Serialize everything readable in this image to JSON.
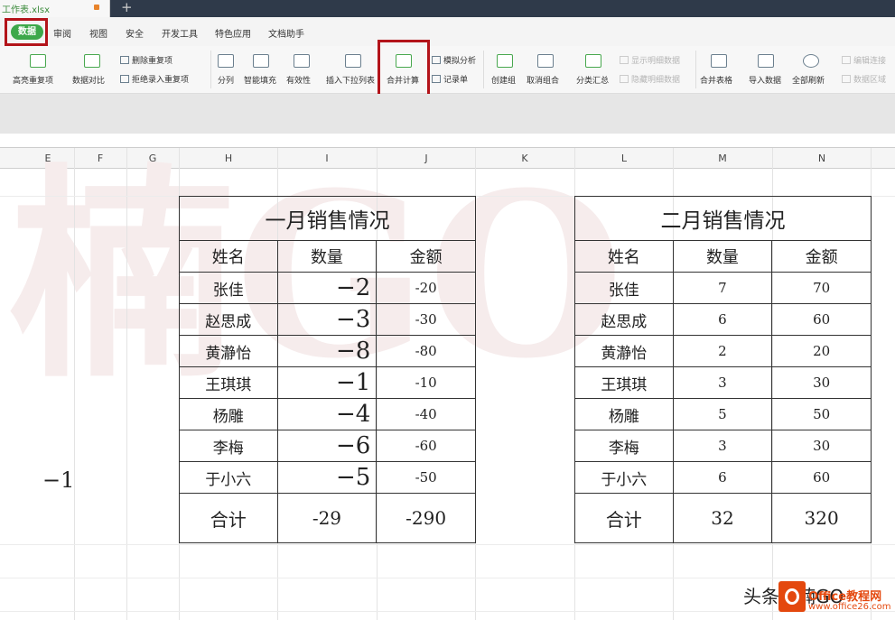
{
  "window": {
    "file_tab": "工作表.xlsx",
    "new_tab_icon": "plus-icon"
  },
  "menu": {
    "items": [
      "数据",
      "审阅",
      "视图",
      "安全",
      "开发工具",
      "特色应用",
      "文档助手"
    ]
  },
  "ribbon": {
    "highlight_dup": "高亮重复项",
    "data_compare": "数据对比",
    "delete_dup": "删除重复项",
    "reject_dup": "拒绝录入重复项",
    "split": "分列",
    "smart_fill": "智能填充",
    "validity": "有效性",
    "insert_dropdown": "插入下拉列表",
    "merge_calc": "合并计算",
    "simulate": "模拟分析",
    "record": "记录单",
    "create_group": "创建组",
    "ungroup": "取消组合",
    "subtotal": "分类汇总",
    "show_detail": "显示明细数据",
    "hide_detail": "隐藏明细数据",
    "merge_tables": "合并表格",
    "import_data": "导入数据",
    "refresh_all": "全部刷新",
    "edit_links": "编辑连接",
    "data_region": "数据区域"
  },
  "columns": [
    "E",
    "F",
    "G",
    "H",
    "I",
    "J",
    "K",
    "L",
    "M",
    "N"
  ],
  "lone_value": "−1",
  "watermark": "楠GO",
  "headers": {
    "name": "姓名",
    "qty": "数量",
    "amount": "金额"
  },
  "january": {
    "title": "一月销售情况",
    "rows": [
      {
        "name": "张佳",
        "qty": "−2",
        "amount": "-20"
      },
      {
        "name": "赵思成",
        "qty": "−3",
        "amount": "-30"
      },
      {
        "name": "黄瀞怡",
        "qty": "−8",
        "amount": "-80"
      },
      {
        "name": "王琪琪",
        "qty": "−1",
        "amount": "-10"
      },
      {
        "name": "杨雕",
        "qty": "−4",
        "amount": "-40"
      },
      {
        "name": "李梅",
        "qty": "−6",
        "amount": "-60"
      },
      {
        "name": "于小六",
        "qty": "−5",
        "amount": "-50"
      }
    ],
    "total_label": "合计",
    "total_qty": "-29",
    "total_amount": "-290"
  },
  "february": {
    "title": "二月销售情况",
    "rows": [
      {
        "name": "张佳",
        "qty": "7",
        "amount": "70"
      },
      {
        "name": "赵思成",
        "qty": "6",
        "amount": "60"
      },
      {
        "name": "黄瀞怡",
        "qty": "2",
        "amount": "20"
      },
      {
        "name": "王琪琪",
        "qty": "3",
        "amount": "30"
      },
      {
        "name": "杨雕",
        "qty": "5",
        "amount": "50"
      },
      {
        "name": "李梅",
        "qty": "3",
        "amount": "30"
      },
      {
        "name": "于小六",
        "qty": "6",
        "amount": "60"
      }
    ],
    "total_label": "合计",
    "total_qty": "32",
    "total_amount": "320"
  },
  "credit": {
    "text": "头条@楠GO",
    "site": "Office教程网",
    "url": "www.office26.com"
  }
}
